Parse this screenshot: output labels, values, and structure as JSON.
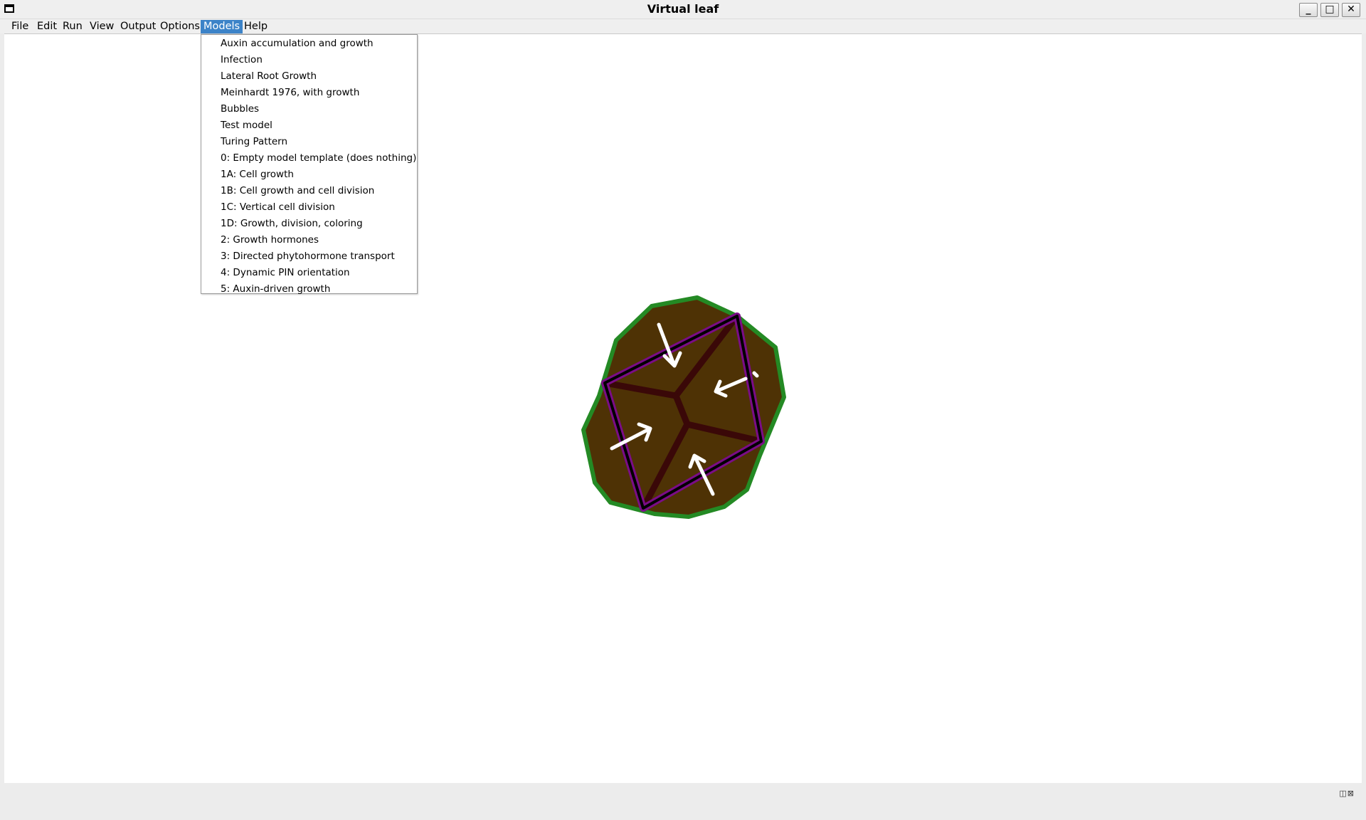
{
  "window": {
    "title": "Virtual leaf",
    "controls": {
      "minimize": "_",
      "maximize": "□",
      "close": "✕"
    }
  },
  "menubar": {
    "items": [
      {
        "label": "File"
      },
      {
        "label": "Edit"
      },
      {
        "label": "Run"
      },
      {
        "label": "View"
      },
      {
        "label": "Output"
      },
      {
        "label": "Options"
      },
      {
        "label": "Models",
        "active": true
      },
      {
        "label": "Help"
      }
    ]
  },
  "models_menu": {
    "items": [
      "Auxin accumulation and growth",
      "Infection",
      "Lateral Root Growth",
      "Meinhardt 1976, with growth",
      "Bubbles",
      "Test model",
      "Turing Pattern",
      "0: Empty model template (does nothing)",
      "1A: Cell growth",
      "1B: Cell growth and cell division",
      "1C: Vertical cell division",
      "1D: Growth, division, coloring",
      "2: Growth hormones",
      "3: Directed phytohormone transport",
      "4: Dynamic PIN orientation",
      "5: Auxin-driven growth"
    ]
  },
  "statusbar": {
    "dock_buttons": "◫⊠"
  },
  "colors": {
    "cell_fill": "#4e3205",
    "outer_border": "#248a24",
    "purple_wall": "#7a0c87",
    "inner_wall": "#3a0808",
    "arrow": "#ffffff",
    "menu_highlight": "#3c83c8"
  }
}
